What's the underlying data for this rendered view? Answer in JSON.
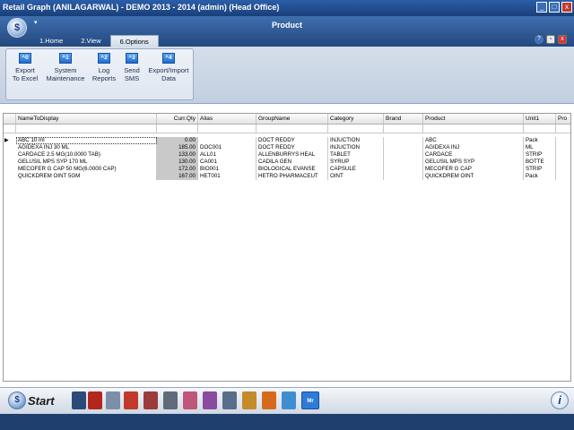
{
  "window": {
    "title": "Retail Graph (ANILAGARWAL) - DEMO  2013 - 2014 (admin) (Head Office)",
    "form_title": "Product",
    "minimize": "_",
    "maximize": "□",
    "close": "x"
  },
  "tabs": [
    {
      "label": "1.Home"
    },
    {
      "label": "2.View"
    },
    {
      "label": "6.Options"
    }
  ],
  "ribbon": {
    "buttons": [
      {
        "key": "^0",
        "label1": "Export",
        "label2": "To Excel"
      },
      {
        "key": "^1",
        "label1": "System",
        "label2": "Maintenance"
      },
      {
        "key": "^2",
        "label1": "Log",
        "label2": "Reports"
      },
      {
        "key": "^3",
        "label1": "Send",
        "label2": "SMS"
      },
      {
        "key": "^4",
        "label1": "Export/Import",
        "label2": "Data"
      }
    ]
  },
  "grid": {
    "columns": [
      "NameToDisplay",
      "Curr.Qty",
      "Alias",
      "GroupName",
      "Category",
      "Brand",
      "Product",
      "Unit1",
      "Pro"
    ],
    "rows": [
      {
        "name": "ABC 10 ml",
        "qty": "0.00",
        "alias": "",
        "group": "DOCT REDDY",
        "category": "INJUCTION",
        "brand": "",
        "product": "ABC",
        "unit": "Pack"
      },
      {
        "name": "AGIDEXA INJ 30 ML",
        "qty": "185.00",
        "alias": "DOC001",
        "group": "DOCT REDDY",
        "category": "INJUCTION",
        "brand": "",
        "product": "AGIDEXA INJ",
        "unit": "ML"
      },
      {
        "name": "CARDACE 2.5 MG(10.0000 TAB)",
        "qty": "133.00",
        "alias": "ALL01",
        "group": "ALLENBURRYS HEAL",
        "category": "TABLET",
        "brand": "",
        "product": "CARDACE",
        "unit": "STRIP"
      },
      {
        "name": "GELUSIL MPS SYP 170 ML",
        "qty": "130.00",
        "alias": "CA001",
        "group": "CADILA GEN",
        "category": "SYRUP",
        "brand": "",
        "product": "GELUSIL MPS SYP",
        "unit": "BOTTE"
      },
      {
        "name": "MECOFER G CAP 50 MG(6.0000 CAP)",
        "qty": "172.00",
        "alias": "BIO001",
        "group": "BIOLOGICAL EVANSE",
        "category": "CAPSULE",
        "brand": "",
        "product": "MECOFER G CAP",
        "unit": "STRIP"
      },
      {
        "name": "QUICKDREM OINT 5GM",
        "qty": "167.00",
        "alias": "HET001",
        "group": "HETRO PHARMACEUT",
        "category": "OINT",
        "brand": "",
        "product": "QUICKDREM OINT",
        "unit": "Pack"
      }
    ]
  },
  "taskbar": {
    "start_label": "Start",
    "info": "i",
    "active_app": "Mr"
  }
}
